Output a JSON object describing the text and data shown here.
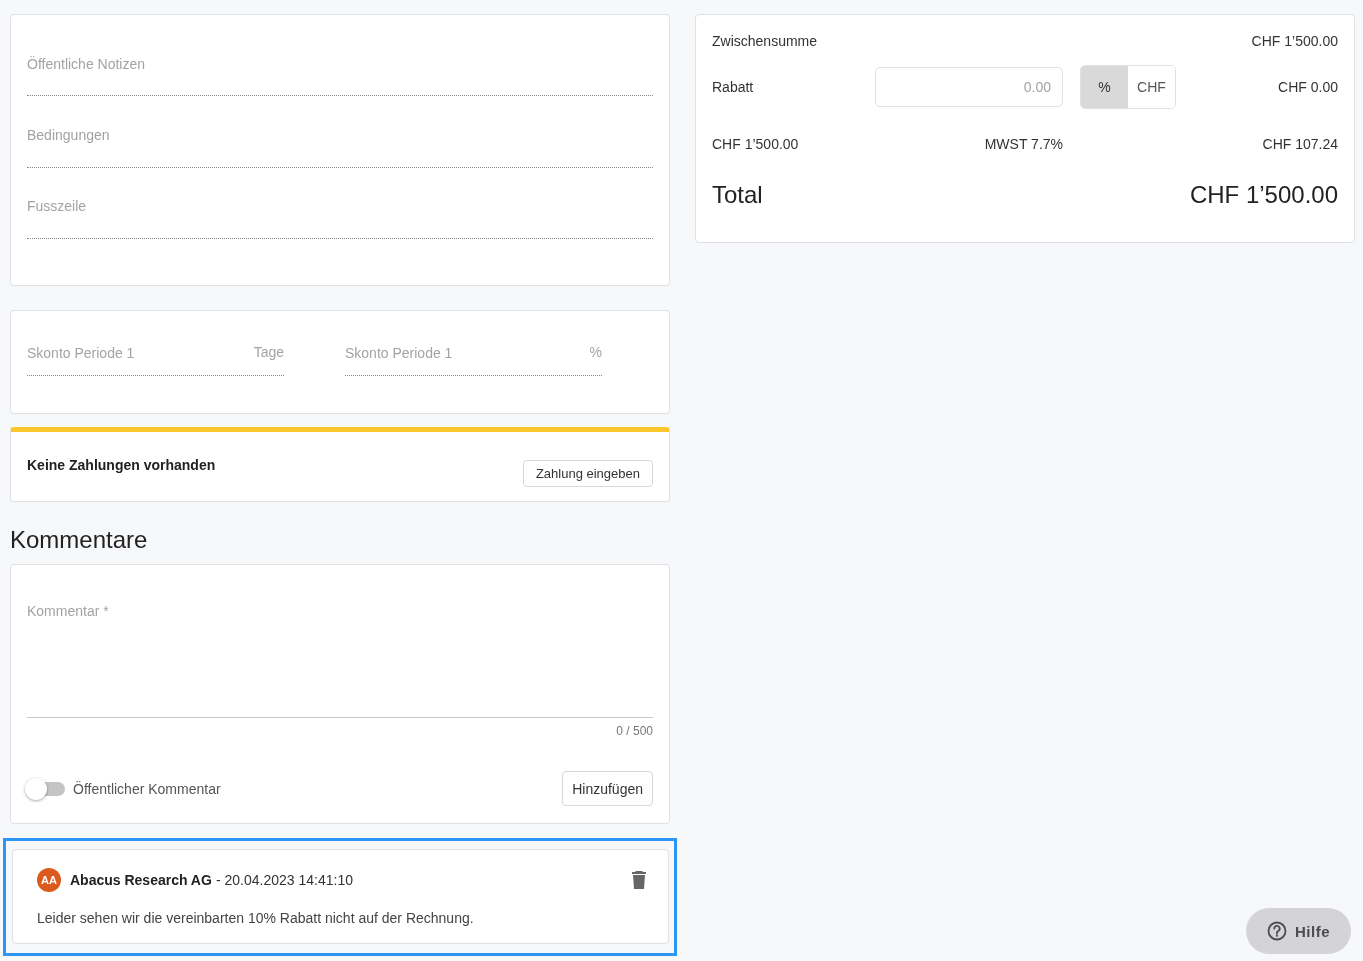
{
  "notes_fields": [
    {
      "placeholder": "Öffentliche Notizen"
    },
    {
      "placeholder": "Bedingungen"
    },
    {
      "placeholder": "Fusszeile"
    }
  ],
  "skonto_fields": [
    {
      "placeholder": "Skonto Periode 1",
      "unit": "Tage"
    },
    {
      "placeholder": "Skonto Periode 1",
      "unit": "%"
    }
  ],
  "payments": {
    "message": "Keine Zahlungen vorhanden",
    "button": "Zahlung eingeben"
  },
  "comments_heading": "Kommentare",
  "comment_form": {
    "placeholder": "Kommentar *",
    "counter": "0 / 500",
    "toggle": {
      "label": "Öffentlicher Kommentar",
      "on": false
    },
    "button": "Hinzufügen"
  },
  "comments": [
    {
      "initials": "AA",
      "author": "Abacus Research AG",
      "separator": "-",
      "timestamp": "20.04.2023 14:41:10",
      "text": "Leider sehen wir die vereinbarten 10% Rabatt nicht auf der Rechnung.",
      "selected": true
    }
  ],
  "totals": {
    "subtotal_label": "Zwischensumme",
    "subtotal": "CHF 1’500.00",
    "discount_label": "Rabatt",
    "discount_placeholder": "0.00",
    "discount_units": [
      {
        "label": "%",
        "selected": true
      },
      {
        "label": "CHF",
        "selected": false
      }
    ],
    "discount_amount": "CHF 0.00",
    "tax_base": "CHF 1’500.00",
    "tax_label": "MWST 7.7%",
    "tax_amount": "CHF 107.24",
    "total_label": "Total",
    "total": "CHF 1’500.00"
  },
  "help_button": "Hilfe"
}
